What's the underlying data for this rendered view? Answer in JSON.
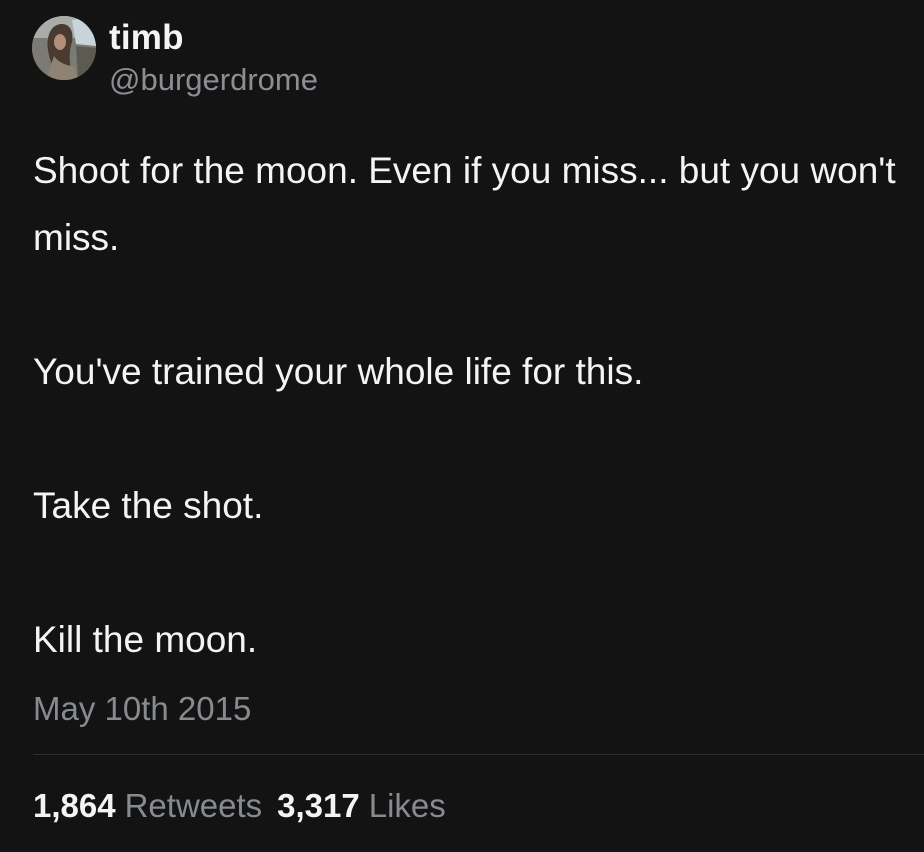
{
  "author": {
    "display_name": "timb",
    "handle": "@burgerdrome",
    "avatar_icon": "profile-photo"
  },
  "tweet": {
    "paragraphs": [
      "Shoot for the moon. Even if you miss... but you won't miss.",
      "You've trained your whole life for this.",
      "Take the shot.",
      "Kill the moon."
    ],
    "timestamp": "May 10th 2015"
  },
  "stats": {
    "retweets_count": "1,864",
    "retweets_label": "Retweets",
    "likes_count": "3,317",
    "likes_label": "Likes"
  },
  "colors": {
    "background": "#131313",
    "text": "#f4f4f4",
    "muted": "#878b90",
    "divider": "#2e2e30"
  }
}
